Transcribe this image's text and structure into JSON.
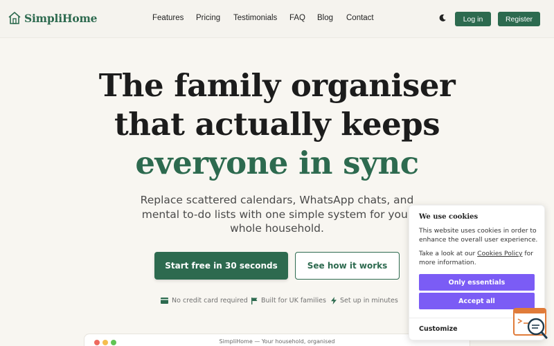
{
  "header": {
    "brand": "SimpliHome",
    "nav": [
      "Features",
      "Pricing",
      "Testimonials",
      "FAQ",
      "Blog",
      "Contact"
    ],
    "login_label": "Log in",
    "register_label": "Register",
    "theme_icon": "moon-icon"
  },
  "hero": {
    "title_line1": "The family organiser",
    "title_line2": "that actually keeps",
    "title_line3": "everyone in sync",
    "subtitle": "Replace scattered calendars, WhatsApp chats, and mental to-do lists with one simple system for your whole household.",
    "cta_primary": "Start free in 30 seconds",
    "cta_secondary": "See how it works",
    "features": [
      {
        "icon": "credit-card-icon",
        "label": "No credit card required"
      },
      {
        "icon": "flag-icon",
        "label": "Built for UK families"
      },
      {
        "icon": "lightning-icon",
        "label": "Set up in minutes"
      }
    ]
  },
  "preview": {
    "window_title": "SimpliHome — Your household, organised"
  },
  "cookie_banner": {
    "title": "We use cookies",
    "text1": "This website uses cookies in order to enhance the overall user experience.",
    "text2_prefix": "Take a look at our ",
    "text2_link": "Cookies Policy",
    "text2_suffix": " for more information.",
    "only_essentials": "Only essentials",
    "accept_all": "Accept all",
    "customize": "Customize"
  },
  "colors": {
    "brand_green": "#2d6a4f",
    "cookie_purple": "#7b5cf5",
    "background": "#f8f6f1"
  }
}
